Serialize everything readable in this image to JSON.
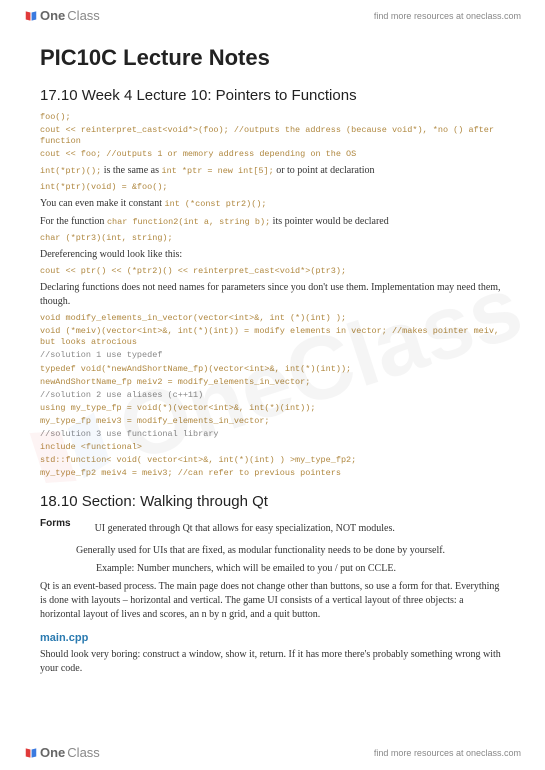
{
  "brand": {
    "prefix": "One",
    "suffix": "Class",
    "tagline": "find more resources at oneclass.com"
  },
  "title": "PIC10C Lecture Notes",
  "section1": {
    "heading": "17.10 Week 4 Lecture 10: Pointers to Functions",
    "code1_a": "foo();",
    "code1_b": "cout << reinterpret_cast<void*>(foo); //outputs the address (because void*), *no () after function",
    "code1_c": "cout << foo; //outputs 1 or memory address depending on the OS",
    "line1_a": "int(*ptr)();",
    "line1_mid": " is the same as ",
    "line1_b": "int *ptr = new int[5];",
    "line1_end": " or to point at declaration",
    "code2": "int(*ptr)(void) = &foo();",
    "line2_pre": "You can even make it constant ",
    "line2_code": "int (*const ptr2)();",
    "line3_pre": "For the function ",
    "line3_code": "char function2(int a, string b);",
    "line3_post": " its pointer would be declared",
    "code3": "char (*ptr3)(int, string);",
    "line4": "Dereferencing would look like this:",
    "code4": "cout << ptr() << (*ptr2)() << reinterpret_cast<void*>(ptr3);",
    "line5": "Declaring functions does not need names for parameters since you don't use them. Implementation may need them, though.",
    "code5_a": "void modify_elements_in_vector(vector<int>&, int (*)(int) );",
    "code5_b": "void (*meiv)(vector<int>&, int(*)(int)) = modify elements in vector; //makes pointer meiv, but looks atrocious",
    "code5_c": "//solution 1 use typedef",
    "code5_d": "typedef void(*newAndShortName_fp)(vector<int>&, int(*)(int));",
    "code5_e": "newAndShortName_fp meiv2 = modify_elements_in_vector;",
    "code5_f": "//solution 2 use aliases (c++11)",
    "code5_g": "using my_type_fp = void(*)(vector<int>&, int(*)(int));",
    "code5_h": "my_type_fp meiv3 = modify_elements_in_vector;",
    "code5_i": "//solution 3 use functional library",
    "code5_j": "include <functional>",
    "code5_k": "std::function< void( vector<int>&, int(*)(int) ) >my_type_fp2;",
    "code5_l": "my_type_fp2 meiv4 = meiv3; //can refer to previous pointers"
  },
  "section2": {
    "heading": "18.10 Section: Walking through Qt",
    "forms_label": "Forms",
    "forms_desc": "UI generated through Qt that allows for easy specialization, NOT modules.",
    "para1": "Generally used for UIs that are fixed, as modular functionality needs to be done by yourself.",
    "para2": "Example: Number munchers, which will be emailed to you / put on CCLE.",
    "para3": "Qt is an event-based process. The main page does not change other than buttons, so use a form for that. Everything is done with layouts – horizontal and vertical. The game UI consists of a vertical layout of three objects: a horizontal layout of lives and scores, an n by n grid, and a quit button.",
    "maincpp": "main.cpp",
    "para4": "Should look very boring: construct a window, show it, return. If it has more there's probably something wrong with your code."
  }
}
